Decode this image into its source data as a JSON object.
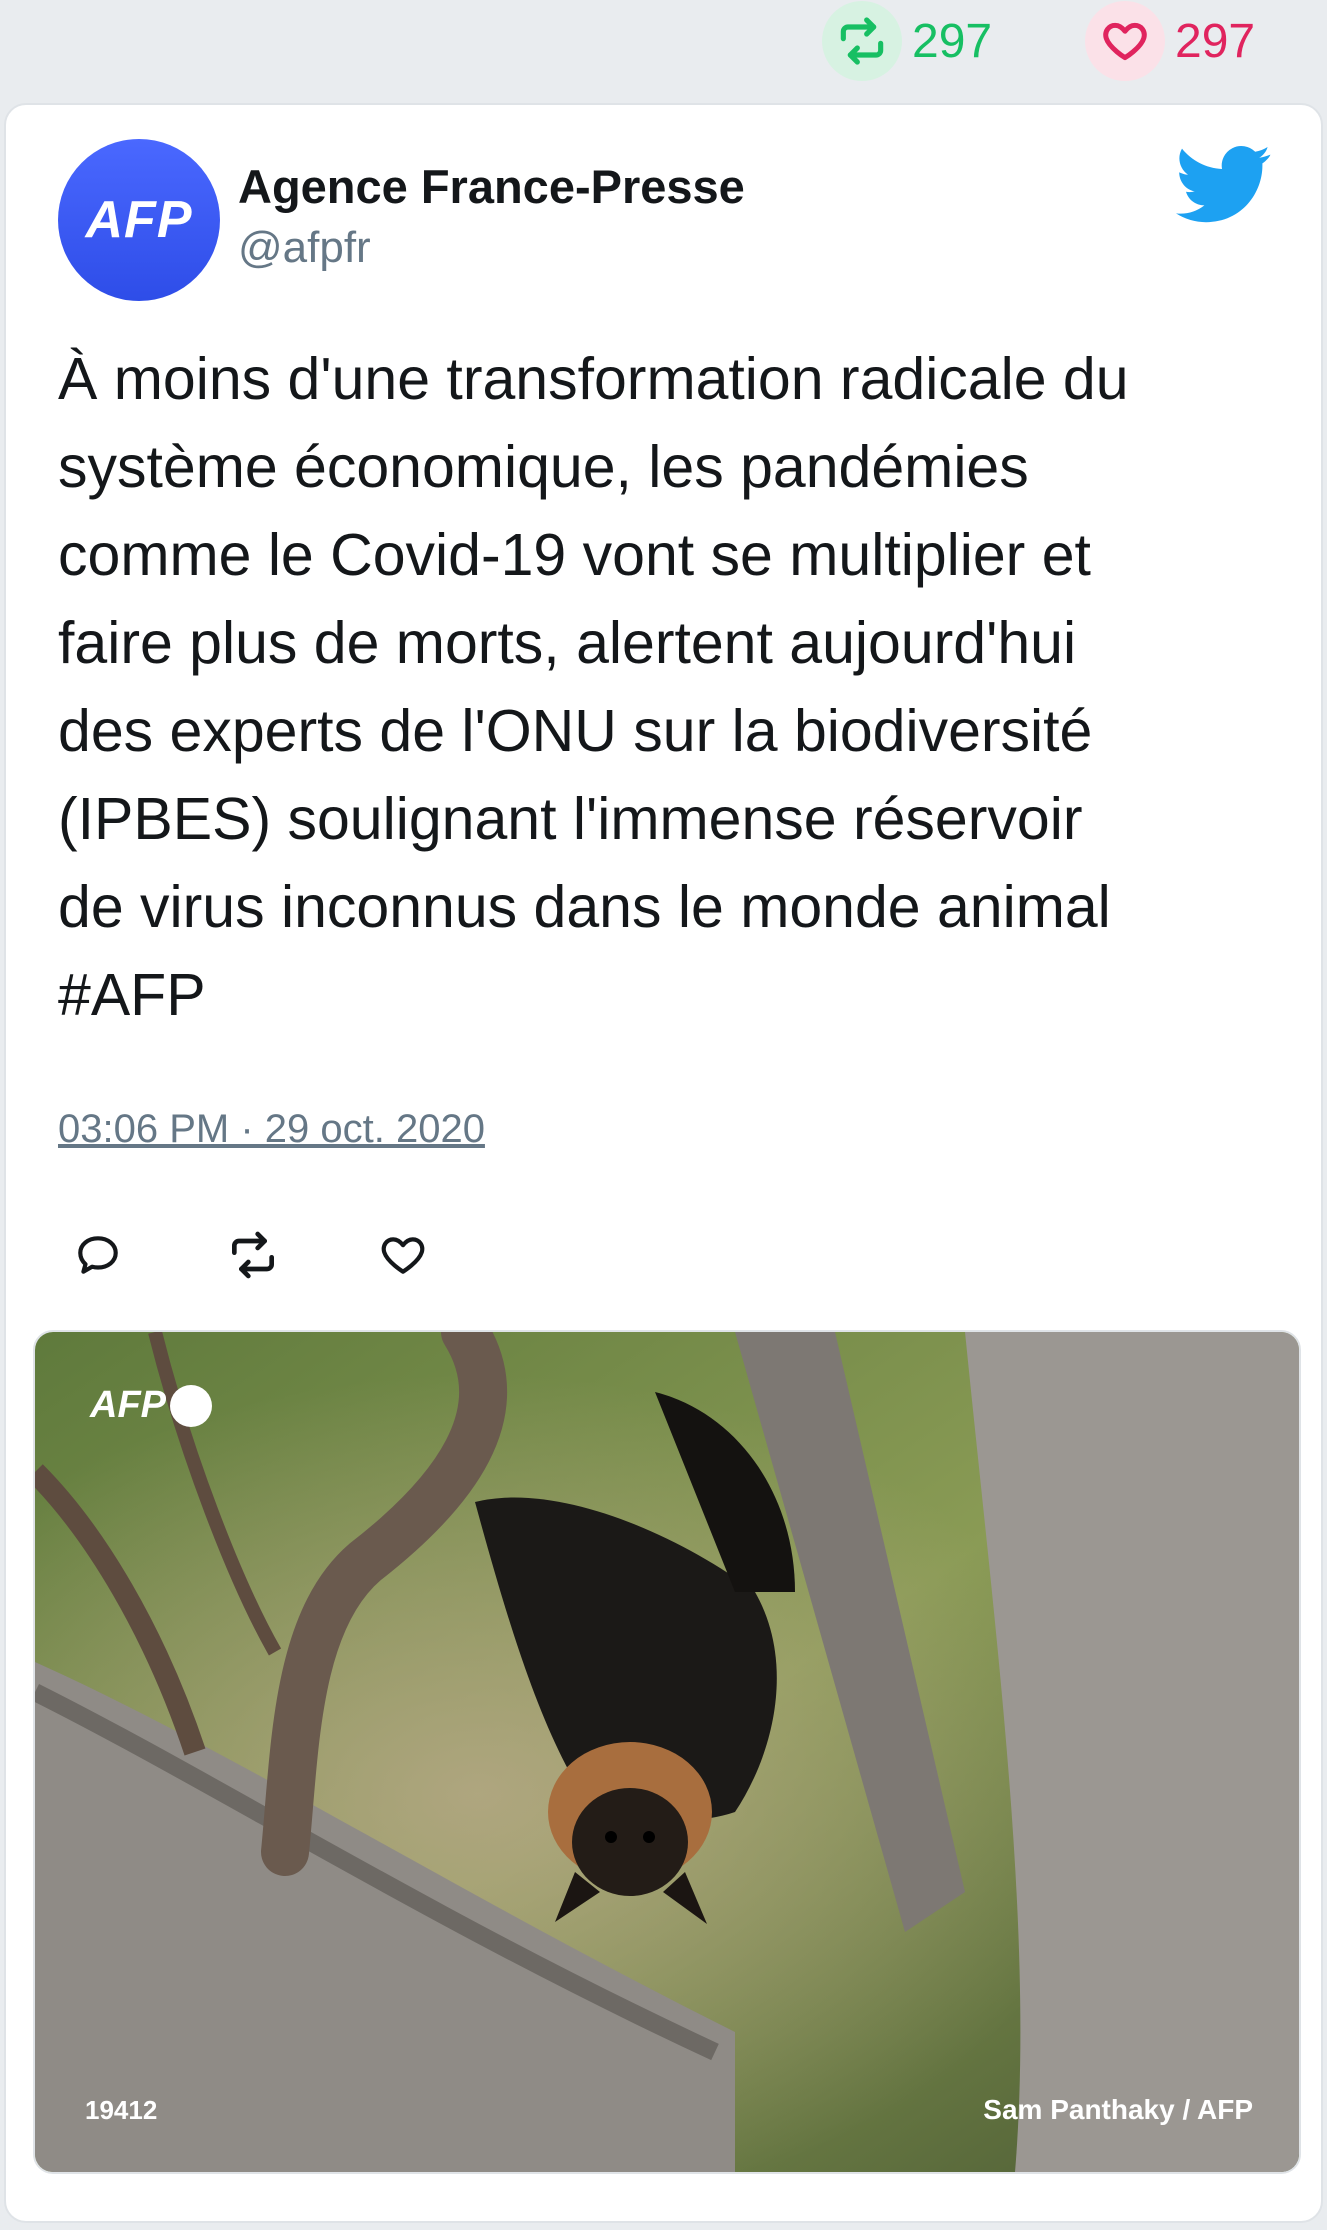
{
  "stats": {
    "retweets": "297",
    "likes": "297"
  },
  "tweet": {
    "author_name": "Agence France-Presse",
    "author_handle": "@afpfr",
    "avatar_text": "AFP",
    "text": "À moins d'une transformation radicale du\nsystème économique, les pandémies\ncomme le Covid-19 vont se multiplier et\nfaire plus de morts, alertent aujourd'hui\ndes experts de l'ONU sur la biodiversité\n(IPBES) soulignant l'immense réservoir\nde virus inconnus dans le monde animal\n#AFP",
    "timestamp": "03:06 PM · 29 oct. 2020"
  },
  "media": {
    "watermark": "AFP",
    "photo_code": "19412",
    "credit": "Sam Panthaky / AFP"
  },
  "icons": [
    "retweet-icon",
    "heart-icon",
    "twitter-bird-icon",
    "reply-icon"
  ],
  "colors": {
    "retweet_green": "#17bf63",
    "like_red": "#e0245e",
    "twitter_blue": "#1da1f2",
    "avatar_blue": "#3b5bf5",
    "muted_gray": "#657786"
  }
}
